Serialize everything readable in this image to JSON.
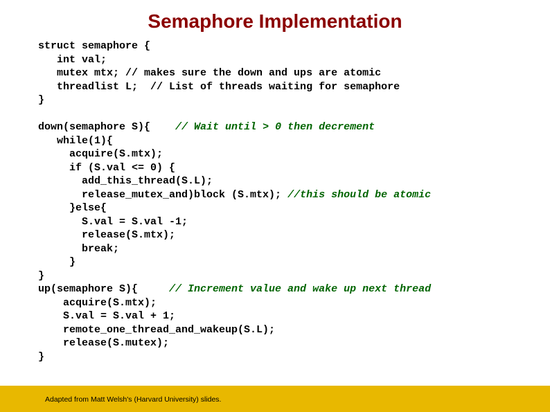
{
  "title": "Semaphore Implementation",
  "struct_lines": {
    "l1": "struct semaphore {",
    "l2": "   int val;",
    "l3": "   mutex mtx; // makes sure the down and ups are atomic",
    "l4": "   threadlist L;  // List of threads waiting for semaphore",
    "l5": "}"
  },
  "down_up": {
    "d1": "down(semaphore S){    ",
    "d1_comment": "// Wait until > 0 then decrement",
    "d2": "   while(1){",
    "d3": "     acquire(S.mtx);",
    "d4": "     if (S.val <= 0) {",
    "d5": "       add_this_thread(S.L);",
    "d6a": "       release_mutex_and)block (S.mtx); ",
    "d6b": "//this should be atomic",
    "d7": "     }else{",
    "d8": "       S.val = S.val -1;",
    "d9": "       release(S.mtx);",
    "d10": "       break;",
    "d11": "     }",
    "d12": "}",
    "u1": "up(semaphore S){     ",
    "u1_comment": "// Increment value and wake up next thread",
    "u2": "    acquire(S.mtx);",
    "u3": "    S.val = S.val + 1;",
    "u4": "    remote_one_thread_and_wakeup(S.L);",
    "u5": "    release(S.mutex);",
    "u6": "}"
  },
  "footer": "Adapted from Matt Welsh's (Harvard University) slides."
}
